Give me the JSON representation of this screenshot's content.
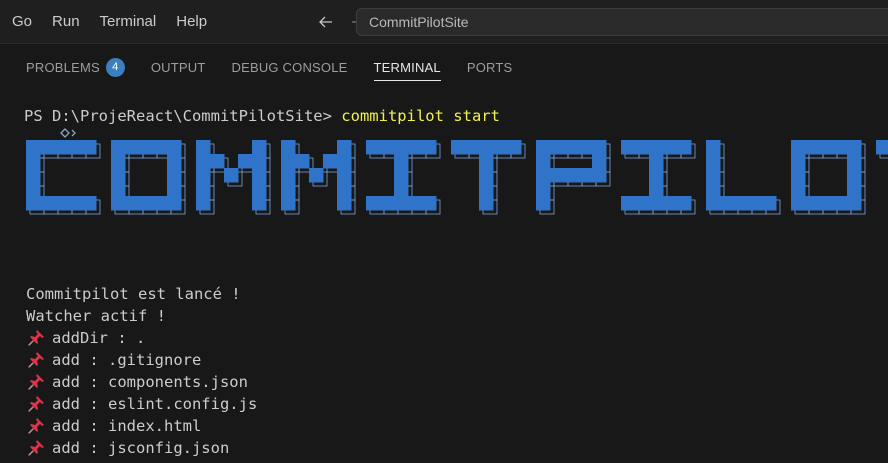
{
  "menubar": {
    "items": [
      "Go",
      "Run",
      "Terminal",
      "Help"
    ],
    "search_text": "CommitPilotSite"
  },
  "panel": {
    "tabs": [
      {
        "label": "PROBLEMS",
        "badge": "4"
      },
      {
        "label": "OUTPUT"
      },
      {
        "label": "DEBUG CONSOLE"
      },
      {
        "label": "TERMINAL",
        "active": true
      },
      {
        "label": "PORTS"
      }
    ]
  },
  "terminal": {
    "prompt": "PS D:\\ProjeReact\\CommitPilotSite>",
    "command": "commitpilot start",
    "banner_text": "COMMITPILOT",
    "banner_color": "#2f74c8",
    "lines": [
      {
        "text": "Commitpilot est lancé !"
      },
      {
        "text": "Watcher actif !"
      },
      {
        "icon": "pushpin-icon",
        "text": "addDir : ."
      },
      {
        "icon": "pushpin-icon",
        "text": "add : .gitignore"
      },
      {
        "icon": "pushpin-icon",
        "text": "add : components.json"
      },
      {
        "icon": "pushpin-icon",
        "text": "add : eslint.config.js"
      },
      {
        "icon": "pushpin-icon",
        "text": "add : index.html"
      },
      {
        "icon": "pushpin-icon",
        "text": "add : jsconfig.json"
      }
    ]
  }
}
